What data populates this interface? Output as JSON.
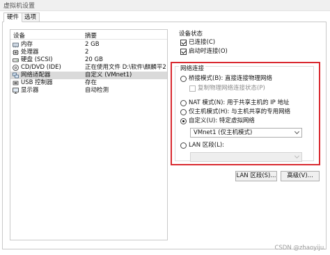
{
  "window": {
    "title": "虚拟机设置"
  },
  "tabs": [
    {
      "label": "硬件",
      "active": true
    },
    {
      "label": "选项",
      "active": false
    }
  ],
  "device_list": {
    "headers": {
      "device": "设备",
      "summary": "摘要"
    },
    "rows": [
      {
        "name": "内存",
        "summary": "2 GB",
        "icon": "memory-icon"
      },
      {
        "name": "处理器",
        "summary": "2",
        "icon": "processor-icon"
      },
      {
        "name": "硬盘 (SCSI)",
        "summary": "20 GB",
        "icon": "hard-disk-icon"
      },
      {
        "name": "CD/DVD (IDE)",
        "summary": "正在使用文件 D:\\软件\\麒麟平2...",
        "icon": "cd-dvd-icon"
      },
      {
        "name": "网络适配器",
        "summary": "自定义 (VMnet1)",
        "icon": "network-adapter-icon",
        "selected": true
      },
      {
        "name": "USB 控制器",
        "summary": "存在",
        "icon": "usb-controller-icon"
      },
      {
        "name": "显示器",
        "summary": "自动检测",
        "icon": "monitor-icon"
      }
    ]
  },
  "device_status": {
    "title": "设备状态",
    "connected": {
      "label": "已连接(C)",
      "checked": true
    },
    "connect_at_power_on": {
      "label": "启动时连接(O)",
      "checked": true
    }
  },
  "network_connection": {
    "title": "网络连接",
    "bridged": {
      "label": "桥接模式(B): 直接连接物理网络",
      "checked": false
    },
    "replicate_state": {
      "label": "复制物理网络连接状态(P)",
      "checked": false,
      "disabled": true
    },
    "nat": {
      "label": "NAT 模式(N): 用于共享主机的 IP 地址",
      "checked": false
    },
    "host_only": {
      "label": "仅主机模式(H): 与主机共享的专用网络",
      "checked": false
    },
    "custom": {
      "label": "自定义(U): 特定虚拟网络",
      "checked": true
    },
    "custom_select": {
      "value": "VMnet1 (仅主机模式)"
    },
    "lan_segment": {
      "label": "LAN 区段(L):",
      "checked": false
    },
    "lan_select": {
      "value": "",
      "disabled": true
    }
  },
  "buttons": {
    "lan_segments": "LAN 区段(S)...",
    "advanced": "高级(V)..."
  },
  "watermark": "CSDN @zhaoyiju.",
  "colors": {
    "highlight": "#d9282f",
    "selection": "#dadada"
  }
}
